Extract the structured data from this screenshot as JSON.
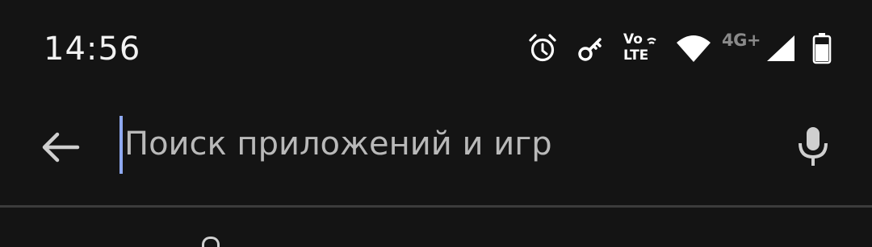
{
  "status_bar": {
    "time": "14:56",
    "icons": [
      "alarm-icon",
      "vpn-key-icon",
      "volte-icon",
      "wifi-icon",
      "mobile-signal-icon",
      "battery-icon"
    ],
    "volte_top": "Vo",
    "volte_bottom": "LTE",
    "network_type": "4G+"
  },
  "search": {
    "back_icon": "arrow-left-icon",
    "placeholder": "Поиск приложений и игр",
    "mic_icon": "microphone-icon",
    "caret_color": "#8fa9f0"
  },
  "colors": {
    "background": "#141414",
    "divider": "#3c3c3c",
    "placeholder_text": "#b9b9b9"
  }
}
